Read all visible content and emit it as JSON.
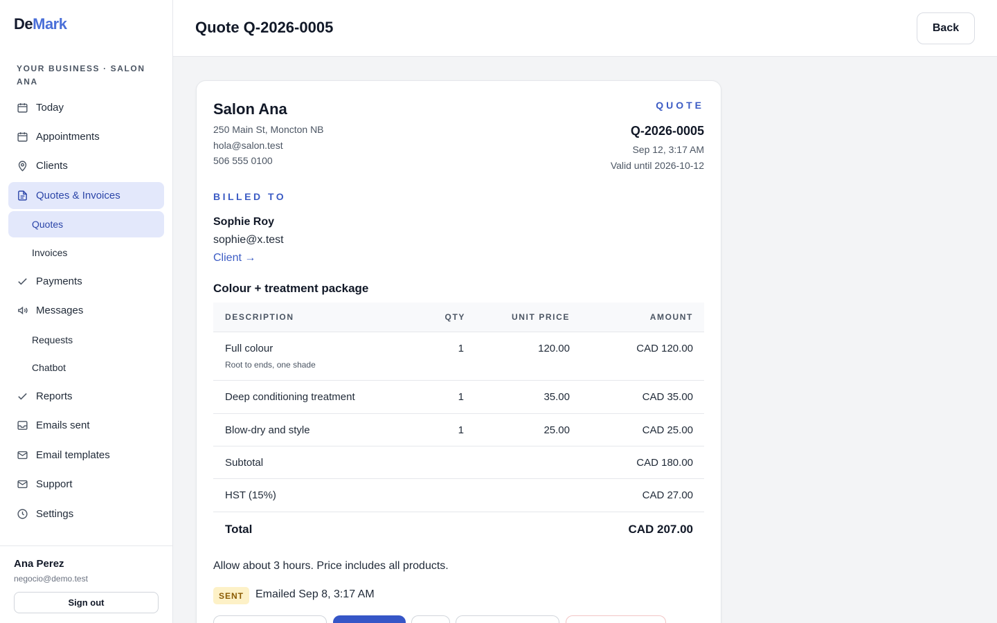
{
  "brand": {
    "part1": "De",
    "part2": "Mark"
  },
  "sidebar": {
    "business_label": "YOUR BUSINESS · SALON ANA",
    "items": [
      {
        "label": "Today",
        "icon": "calendar-icon"
      },
      {
        "label": "Appointments",
        "icon": "calendar-icon"
      },
      {
        "label": "Clients",
        "icon": "map-pin-icon"
      },
      {
        "label": "Quotes & Invoices",
        "icon": "document-icon",
        "active": true
      },
      {
        "label": "Quotes",
        "sub": true,
        "active": true
      },
      {
        "label": "Invoices",
        "sub": true
      },
      {
        "label": "Payments",
        "icon": "check-icon"
      },
      {
        "label": "Messages",
        "icon": "megaphone-icon"
      },
      {
        "label": "Requests",
        "sub": true
      },
      {
        "label": "Chatbot",
        "sub": true
      },
      {
        "label": "Reports",
        "icon": "check-icon"
      },
      {
        "label": "Emails sent",
        "icon": "inbox-icon"
      },
      {
        "label": "Email templates",
        "icon": "mail-icon"
      },
      {
        "label": "Support",
        "icon": "mail-icon"
      },
      {
        "label": "Settings",
        "icon": "clock-icon"
      }
    ],
    "user": {
      "name": "Ana Perez",
      "email": "negocio@demo.test",
      "signout_label": "Sign out"
    }
  },
  "header": {
    "title": "Quote Q-2026-0005",
    "back_label": "Back"
  },
  "quote": {
    "business": {
      "name": "Salon Ana",
      "address": "250 Main St, Moncton NB",
      "email": "hola@salon.test",
      "phone": "506 555 0100"
    },
    "doc_label": "QUOTE",
    "number": "Q-2026-0005",
    "date": "Sep 12, 3:17 AM",
    "valid_until": "Valid until 2026-10-12",
    "billed_to_label": "BILLED TO",
    "client": {
      "name": "Sophie Roy",
      "email": "sophie@x.test",
      "link_label": "Client →"
    },
    "package_title": "Colour + treatment package",
    "columns": [
      "DESCRIPTION",
      "QTY",
      "UNIT PRICE",
      "AMOUNT"
    ],
    "lines": [
      {
        "description": "Full colour",
        "note": "Root to ends, one shade",
        "qty": "1",
        "unit_price": "120.00",
        "amount": "CAD 120.00"
      },
      {
        "description": "Deep conditioning treatment",
        "note": "",
        "qty": "1",
        "unit_price": "35.00",
        "amount": "CAD 35.00"
      },
      {
        "description": "Blow-dry and style",
        "note": "",
        "qty": "1",
        "unit_price": "25.00",
        "amount": "CAD 25.00"
      }
    ],
    "subtotal": {
      "label": "Subtotal",
      "value": "CAD 180.00"
    },
    "tax": {
      "label": "HST (15%)",
      "value": "CAD 27.00"
    },
    "total": {
      "label": "Total",
      "value": "CAD 207.00"
    },
    "notes": "Allow about 3 hours. Price includes all products.",
    "status": {
      "badge": "SENT",
      "text": "Emailed Sep 8, 3:17 AM"
    }
  },
  "colors": {
    "accent": "#3b5bc4",
    "active_bg": "#e3e8fb",
    "badge_bg": "#fdf1c7",
    "badge_fg": "#8a5a00"
  }
}
